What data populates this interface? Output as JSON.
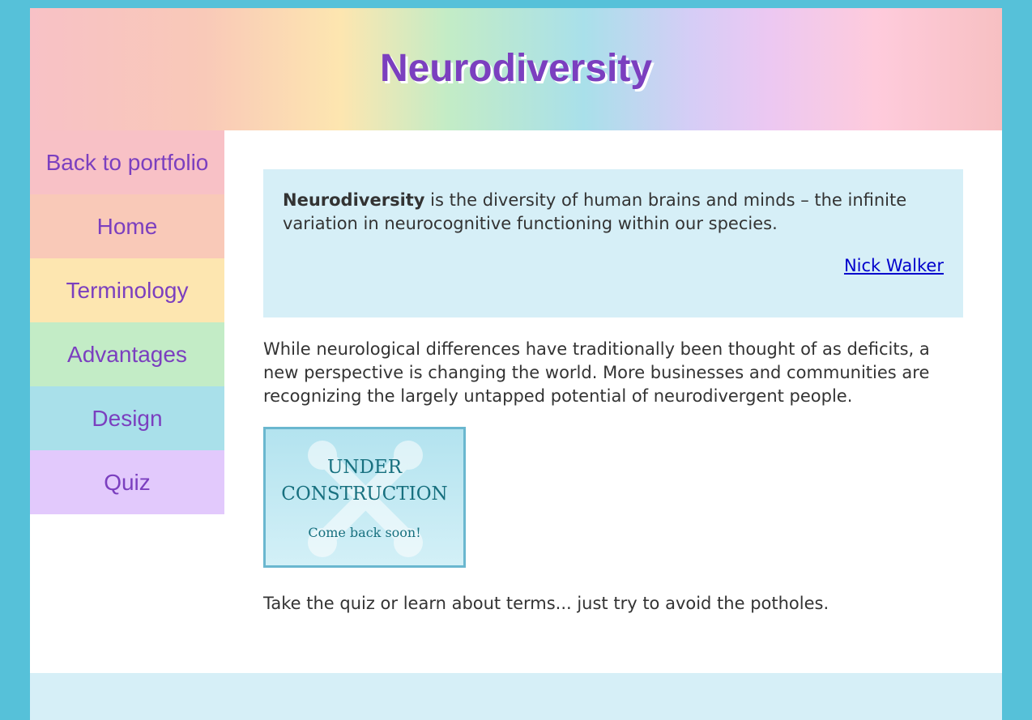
{
  "header": {
    "title": "Neurodiversity"
  },
  "nav": {
    "items": [
      {
        "label": "Back to portfolio"
      },
      {
        "label": "Home"
      },
      {
        "label": "Terminology"
      },
      {
        "label": "Advantages"
      },
      {
        "label": "Design"
      },
      {
        "label": "Quiz"
      }
    ]
  },
  "quote": {
    "term": "Neurodiversity",
    "text": " is the diversity of human brains and minds – the infinite variation in neurocognitive functioning within our species.",
    "cite": "Nick Walker"
  },
  "main": {
    "paragraph": "While neurological differences have traditionally been thought of as deficits, a new perspective is changing the world. More businesses and communities are recognizing the largely untapped potential of neurodivergent people.",
    "closing": "Take the quiz or learn about terms... just try to avoid the potholes."
  },
  "construction_image": {
    "line1": "UNDER",
    "line2": "CONSTRUCTION",
    "line3": "Come back soon!",
    "icon": "wrench-cross-icon"
  },
  "colors": {
    "page_bg": "#56c1d9",
    "title": "#7b3fbf",
    "quote_bg": "#d6eff7",
    "link": "#0000cc"
  }
}
